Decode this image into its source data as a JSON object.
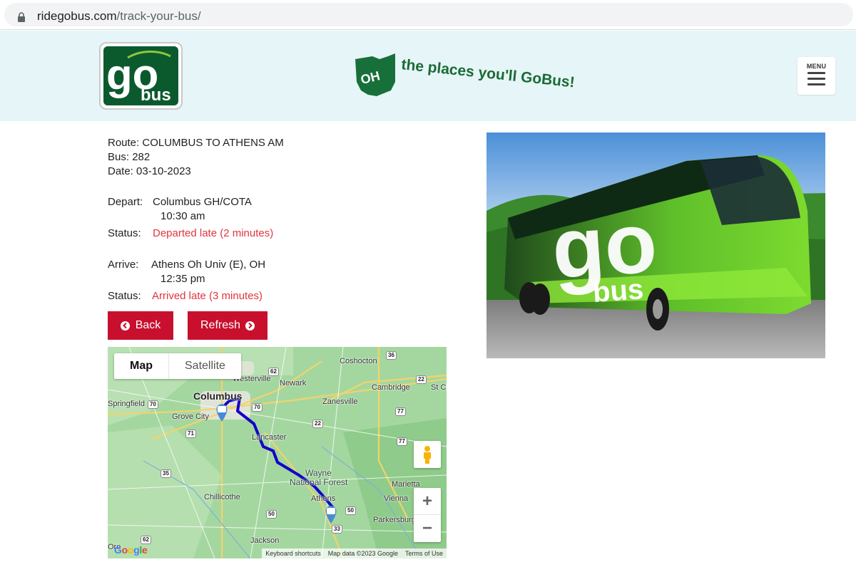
{
  "browser": {
    "url_domain": "ridegobus.com",
    "url_path": "/track-your-bus/"
  },
  "header": {
    "logo_text_main": "go",
    "logo_text_sub": "bus",
    "tagline_state": "OH",
    "tagline_text": "the places you'll GoBus!",
    "menu_label": "MENU"
  },
  "trip": {
    "route_label": "Route:",
    "route_value": "COLUMBUS TO ATHENS AM",
    "bus_label": "Bus:",
    "bus_value": "282",
    "date_label": "Date:",
    "date_value": "03-10-2023",
    "depart_label": "Depart:",
    "depart_location": "Columbus GH/COTA",
    "depart_time": "10:30 am",
    "depart_status_label": "Status:",
    "depart_status": "Departed late (2 minutes)",
    "arrive_label": "Arrive:",
    "arrive_location": "Athens Oh Univ (E), OH",
    "arrive_time": "12:35 pm",
    "arrive_status_label": "Status:",
    "arrive_status": "Arrived late (3 minutes)"
  },
  "buttons": {
    "back": "Back",
    "refresh": "Refresh"
  },
  "map": {
    "tab_map": "Map",
    "tab_satellite": "Satellite",
    "zoom_in": "+",
    "zoom_out": "−",
    "footer_shortcuts": "Keyboard shortcuts",
    "footer_data": "Map data ©2023 Google",
    "footer_terms": "Terms of Use",
    "google_logo": "Google",
    "places": {
      "columbus": "Columbus",
      "westerville": "Westerville",
      "newark": "Newark",
      "coshocton": "Coshocton",
      "cambridge": "Cambridge",
      "springfield": "Springfield",
      "grove_city": "Grove City",
      "zanesville": "Zanesville",
      "lancaster": "Lancaster",
      "wayne": "Wayne",
      "national_forest": "National Forest",
      "chillicothe": "Chillicothe",
      "athens": "Athens",
      "marietta": "Marietta",
      "vienna": "Vienna",
      "parkersburg": "Parkersburg",
      "jackson": "Jackson",
      "st_cl": "St Cl",
      "ore": "Ore"
    },
    "shields": [
      "36",
      "22",
      "62",
      "70",
      "77",
      "22",
      "71",
      "35",
      "50",
      "50",
      "33",
      "62",
      "77",
      "70"
    ]
  },
  "colors": {
    "brand_red": "#c8102e",
    "brand_green": "#006633",
    "late_text": "#e0353f",
    "header_bg": "#e6f5f7",
    "route_line": "#1400c8"
  }
}
